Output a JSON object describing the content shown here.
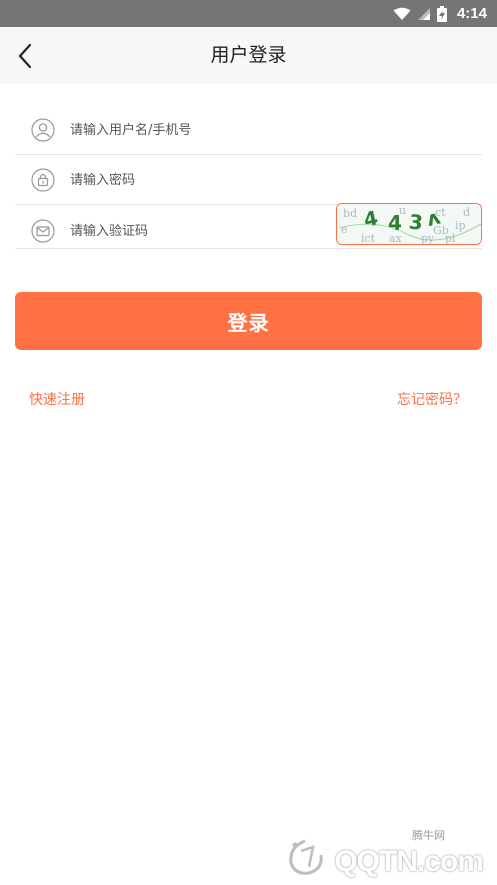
{
  "status_bar": {
    "time": "4:14",
    "icons": [
      "wifi-icon",
      "signal-icon",
      "battery-charging-icon"
    ]
  },
  "header": {
    "title": "用户登录",
    "back_icon": "chevron-left-icon"
  },
  "form": {
    "username": {
      "placeholder": "请输入用户名/手机号",
      "value": "",
      "icon": "user-icon"
    },
    "password": {
      "placeholder": "请输入密码",
      "value": "",
      "icon": "lock-icon"
    },
    "captcha": {
      "placeholder": "请输入验证码",
      "value": "",
      "icon": "mail-icon",
      "captcha_text": "443"
    },
    "login_label": "登录"
  },
  "links": {
    "register": "快速注册",
    "forgot": "忘记密码？"
  },
  "watermark": {
    "small": "腾牛网",
    "main": "QQTN.com"
  },
  "colors": {
    "accent": "#ff7043",
    "status_bar": "#757575",
    "header_bg": "#f7f7f7",
    "divider": "#e6e6e6"
  }
}
